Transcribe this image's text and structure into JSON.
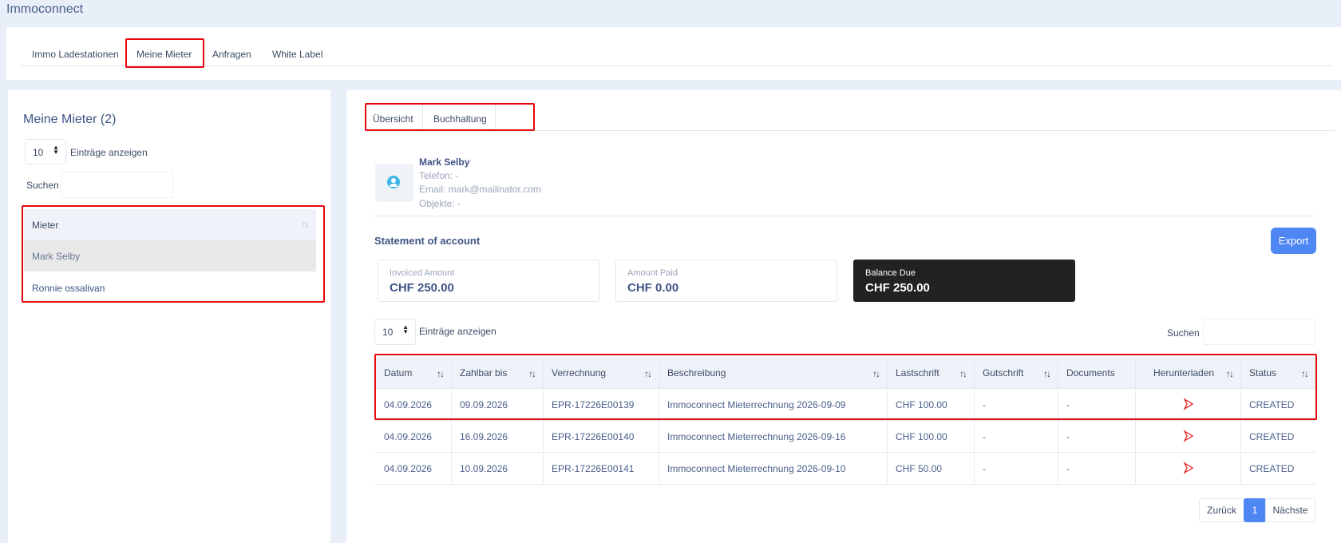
{
  "app": {
    "title": "Immoconnect"
  },
  "topnav": {
    "tabs": [
      {
        "label": "Immo Ladestationen"
      },
      {
        "label": "Meine Mieter"
      },
      {
        "label": "Anfragen"
      },
      {
        "label": "White Label"
      }
    ],
    "active": "Meine Mieter"
  },
  "left": {
    "title": "Meine Mieter (2)",
    "page_size": "10",
    "page_size_label": "Einträge anzeigen",
    "search_label": "Suchen",
    "search_value": "",
    "column": "Mieter",
    "rows": [
      "Mark Selby",
      "Ronnie ossalivan"
    ],
    "selected": "Mark Selby"
  },
  "right": {
    "tabs": [
      {
        "label": "Übersicht"
      },
      {
        "label": "Buchhaltung"
      }
    ],
    "tenant": {
      "name": "Mark Selby",
      "phone": "Telefon: -",
      "email": "Email: mark@mailinator.com",
      "objects": "Objekte: -"
    },
    "statement_title": "Statement of account",
    "export_label": "Export",
    "summary": {
      "invoiced_label": "Invoiced Amount",
      "invoiced_value": "CHF 250.00",
      "paid_label": "Amount Paid",
      "paid_value": "CHF 0.00",
      "balance_label": "Balance Due",
      "balance_value": "CHF 250.00"
    },
    "page_size": "10",
    "page_size_label": "Einträge anzeigen",
    "search_label": "Suchen",
    "search_value": "",
    "columns": [
      "Datum",
      "Zahlbar bis",
      "Verrechnung",
      "Beschreibung",
      "Lastschrift",
      "Gutschrift",
      "Documents",
      "Herunterladen",
      "Status"
    ],
    "rows": [
      [
        "04.09.2026",
        "09.09.2026",
        "EPR-17226E00139",
        "Immoconnect Mieterrechnung 2026-09-09",
        "CHF 100.00",
        "-",
        "-",
        "",
        "CREATED"
      ],
      [
        "04.09.2026",
        "16.09.2026",
        "EPR-17226E00140",
        "Immoconnect Mieterrechnung 2026-09-16",
        "CHF 100.00",
        "-",
        "-",
        "",
        "CREATED"
      ],
      [
        "04.09.2026",
        "10.09.2026",
        "EPR-17226E00141",
        "Immoconnect Mieterrechnung 2026-09-10",
        "CHF 50.00",
        "-",
        "-",
        "",
        "CREATED"
      ]
    ],
    "pagination": {
      "prev": "Zurück",
      "current": "1",
      "next": "Nächste"
    }
  },
  "colors": {
    "accent": "#4e86f3",
    "highlight": "#e6060d",
    "dark_box": "#222222"
  },
  "icons": {
    "download": "pdf-icon",
    "sort": "sort-icon",
    "avatar": "user-icon"
  }
}
